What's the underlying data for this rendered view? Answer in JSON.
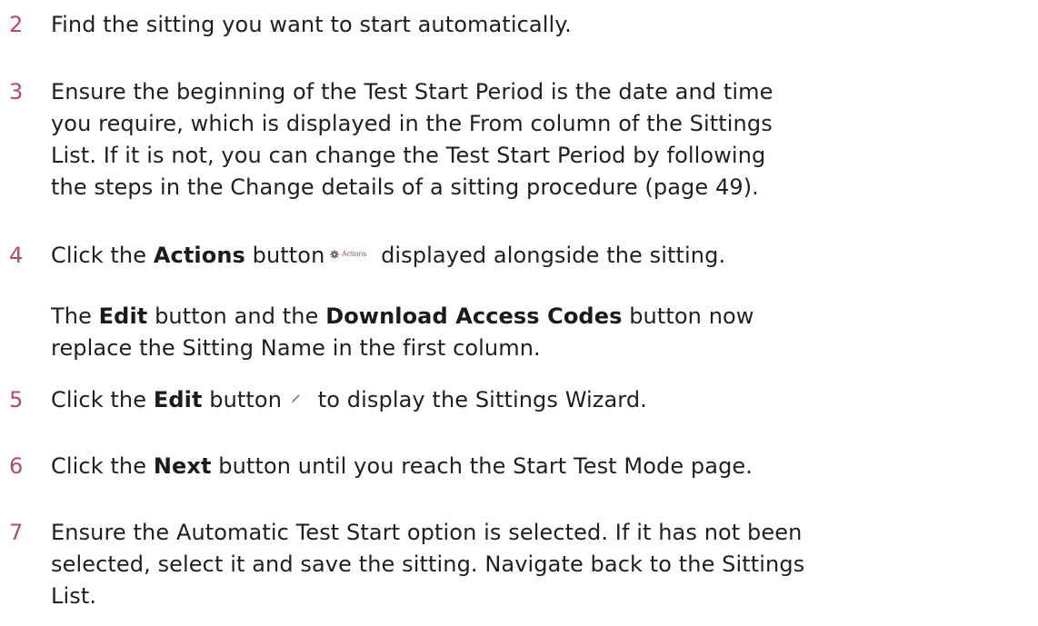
{
  "colors": {
    "step_number": "#b34a6a",
    "body_text": "#1f1f1f",
    "actions_icon": "#7a5c68"
  },
  "icons": {
    "actions": "gear-icon",
    "edit": "pencil-icon"
  },
  "steps": [
    {
      "num": "2",
      "lines": [
        "Find the sitting you want to start automatically."
      ]
    },
    {
      "num": "3",
      "lines": [
        "Ensure the beginning of the Test Start Period is the date and time",
        "you require, which is displayed in the From column of the Sittings",
        "List. If it is not, you can change the Test Start Period by following",
        "the steps in the Change details of a sitting procedure (page 49)."
      ]
    },
    {
      "num": "4",
      "pre": "Click the ",
      "bold": "Actions",
      "mid": " button",
      "icon_label": "Actions",
      "post": " displayed alongside the sitting."
    },
    {
      "para_a": "The ",
      "bold_a": "Edit",
      "para_b": " button and the ",
      "bold_b": "Download Access Codes",
      "para_c": " button now",
      "line2": "replace the Sitting Name in the first column."
    },
    {
      "num": "5",
      "pre": "Click the ",
      "bold": "Edit",
      "mid": " button",
      "post": " to display the Sittings Wizard."
    },
    {
      "num": "6",
      "pre": "Click the ",
      "bold": "Next",
      "post": " button until you reach the Start Test Mode page."
    },
    {
      "num": "7",
      "lines": [
        "Ensure the Automatic Test Start option is selected. If it has not been",
        "selected, select it and save the sitting. Navigate back to the Sittings",
        "List."
      ]
    }
  ]
}
